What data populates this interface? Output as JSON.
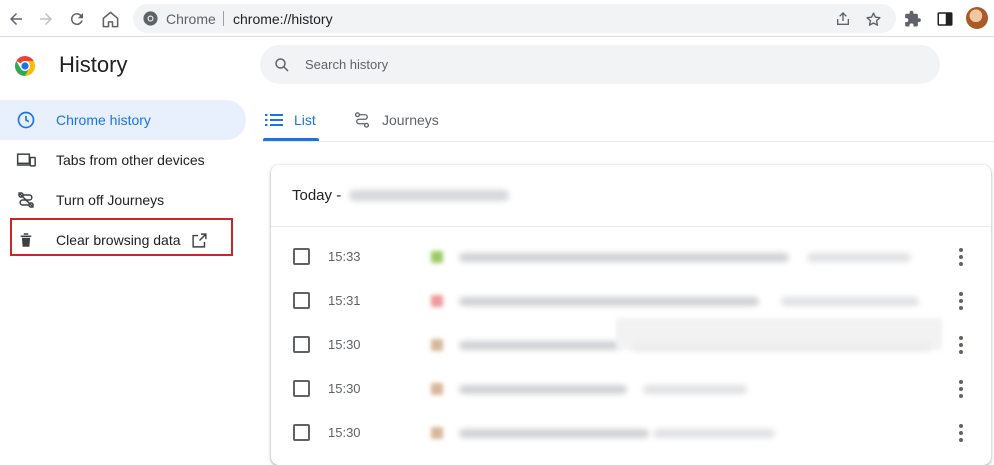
{
  "toolbar": {
    "omnibox_site_label": "Chrome",
    "omnibox_url": "chrome://history"
  },
  "page": {
    "title": "History"
  },
  "search": {
    "placeholder": "Search history"
  },
  "sidebar": {
    "items": [
      {
        "label": "Chrome history",
        "icon": "clock-icon",
        "active": true
      },
      {
        "label": "Tabs from other devices",
        "icon": "devices-icon",
        "active": false
      },
      {
        "label": "Turn off Journeys",
        "icon": "journeys-off-icon",
        "active": false
      },
      {
        "label": "Clear browsing data",
        "icon": "trash-icon",
        "active": false,
        "external": true
      }
    ]
  },
  "tabs": [
    {
      "label": "List",
      "icon": "list-icon",
      "selected": true
    },
    {
      "label": "Journeys",
      "icon": "journeys-icon",
      "selected": false
    }
  ],
  "history": {
    "group_label": "Today -",
    "rows": [
      {
        "time": "15:33"
      },
      {
        "time": "15:31"
      },
      {
        "time": "15:30"
      },
      {
        "time": "15:30"
      },
      {
        "time": "15:30"
      }
    ]
  },
  "colors": {
    "accent": "#1a73e8",
    "active_bg": "#e8f0fe",
    "highlight": "#c62828"
  }
}
